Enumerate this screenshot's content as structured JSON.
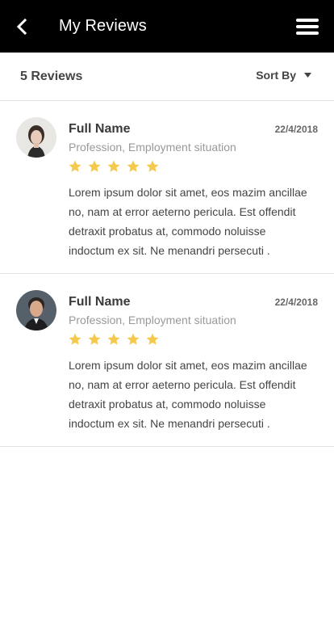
{
  "appbar": {
    "title": "My Reviews",
    "back_icon": "back-arrow-icon",
    "menu_icon": "hamburger-menu-icon"
  },
  "summary": {
    "count_label": "5 Reviews",
    "sort_label": "Sort By",
    "sort_icon": "caret-down-icon"
  },
  "reviews": [
    {
      "name": "Full Name",
      "date": "22/4/2018",
      "profession": "Profession, Employment situation",
      "rating": 5,
      "text": "Lorem ipsum dolor sit amet, eos mazim ancillae no, nam at error aeterno pericula. Est offendit detraxit probatus at, commodo noluisse indoctum ex sit. Ne menandri persecuti ."
    },
    {
      "name": "Full Name",
      "date": "22/4/2018",
      "profession": "Profession, Employment situation",
      "rating": 5,
      "text": "Lorem ipsum dolor sit amet, eos mazim ancillae no, nam at error aeterno pericula. Est offendit detraxit probatus at, commodo noluisse indoctum ex sit. Ne menandri persecuti ."
    }
  ],
  "colors": {
    "appbar_bg": "#000000",
    "star": "#F5C94C",
    "divider": "#E3E3E3"
  }
}
